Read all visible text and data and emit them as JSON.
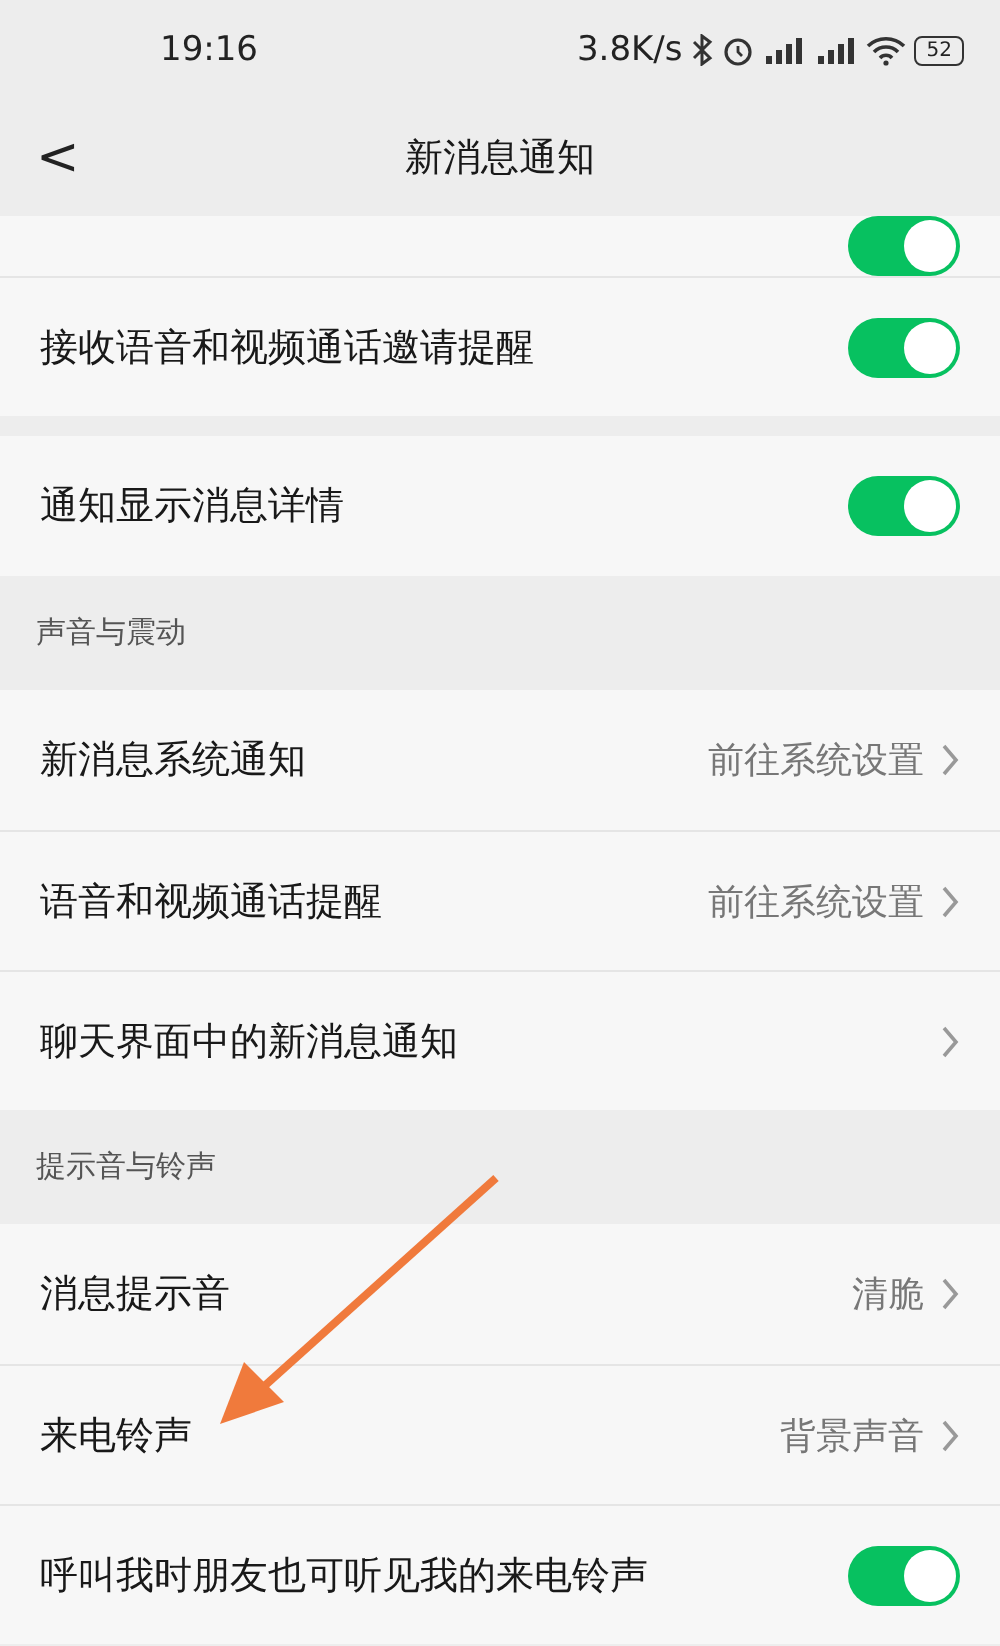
{
  "status_bar": {
    "time": "19:16",
    "speed": "3.8K/s",
    "battery": "52"
  },
  "header": {
    "back": "<",
    "title": "新消息通知"
  },
  "partial_row": {
    "on": true
  },
  "groups": [
    {
      "rows": [
        {
          "kind": "toggle",
          "label": "接收语音和视频通话邀请提醒",
          "on": true
        }
      ]
    },
    {
      "rows": [
        {
          "kind": "toggle",
          "label": "通知显示消息详情",
          "on": true
        }
      ]
    },
    {
      "header": "声音与震动",
      "rows": [
        {
          "kind": "link",
          "label": "新消息系统通知",
          "value": "前往系统设置"
        },
        {
          "kind": "link",
          "label": "语音和视频通话提醒",
          "value": "前往系统设置"
        },
        {
          "kind": "link",
          "label": "聊天界面中的新消息通知"
        }
      ]
    },
    {
      "header": "提示音与铃声",
      "rows": [
        {
          "kind": "link",
          "label": "消息提示音",
          "value": "清脆"
        },
        {
          "kind": "link",
          "label": "来电铃声",
          "value": "背景声音"
        },
        {
          "kind": "toggle",
          "label": "呼叫我时朋友也可听见我的来电铃声",
          "on": true
        }
      ]
    }
  ]
}
